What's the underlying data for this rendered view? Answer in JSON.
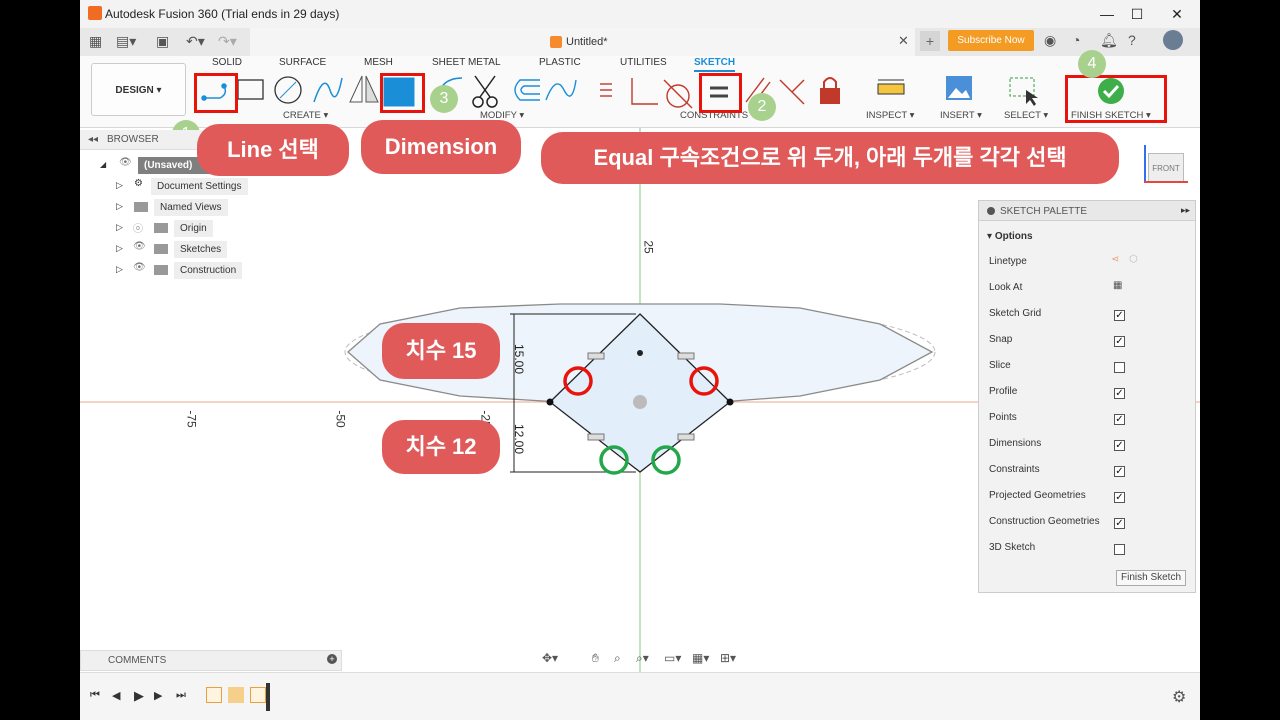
{
  "titlebar": {
    "app_title": "Autodesk Fusion 360 (Trial ends in 29 days)"
  },
  "appbar": {
    "doc_title": "Untitled*",
    "subscribe": "Subscribe Now"
  },
  "ribbon": {
    "tabs": [
      "SOLID",
      "SURFACE",
      "MESH",
      "SHEET METAL",
      "PLASTIC",
      "UTILITIES",
      "SKETCH"
    ],
    "active_tab": "SKETCH",
    "design": "DESIGN ▾",
    "groups": {
      "create": "CREATE ▾",
      "modify": "MODIFY ▾",
      "constraints": "CONSTRAINTS ▾",
      "inspect": "INSPECT ▾",
      "insert": "INSERT ▾",
      "select": "SELECT ▾",
      "finish": "FINISH SKETCH ▾"
    }
  },
  "annotations": {
    "n1": "1",
    "n2": "2",
    "n3": "3",
    "n4": "4",
    "line_select": "Line 선택",
    "dimension": "Dimension",
    "equal_note": "Equal 구속조건으로 위 두개, 아래 두개를 각각 선택",
    "dim15": "치수 15",
    "dim12": "치수 12"
  },
  "browser": {
    "title": "BROWSER",
    "root": "(Unsaved)",
    "items": [
      "Document Settings",
      "Named Views",
      "Origin",
      "Sketches",
      "Construction"
    ]
  },
  "viewcube": {
    "face": "FRONT"
  },
  "canvas": {
    "axis_labels": [
      "-75",
      "-50",
      "-25",
      "25"
    ],
    "dim_upper": "15.00",
    "dim_lower": "12.00"
  },
  "palette": {
    "title": "SKETCH PALETTE",
    "section": "Options",
    "rows": [
      {
        "label": "Linetype",
        "checked": null
      },
      {
        "label": "Look At",
        "checked": null
      },
      {
        "label": "Sketch Grid",
        "checked": true
      },
      {
        "label": "Snap",
        "checked": true
      },
      {
        "label": "Slice",
        "checked": false
      },
      {
        "label": "Profile",
        "checked": true
      },
      {
        "label": "Points",
        "checked": true
      },
      {
        "label": "Dimensions",
        "checked": true
      },
      {
        "label": "Constraints",
        "checked": true
      },
      {
        "label": "Projected Geometries",
        "checked": true
      },
      {
        "label": "Construction Geometries",
        "checked": true
      },
      {
        "label": "3D Sketch",
        "checked": false
      }
    ],
    "finish_btn": "Finish Sketch"
  },
  "comments": {
    "title": "COMMENTS"
  },
  "colors": {
    "accent_red": "#e8140c",
    "callout": "#e05a5a",
    "step": "#a9d18e",
    "subscribe": "#f49b23",
    "sketch_tab": "#1a8fd8"
  }
}
